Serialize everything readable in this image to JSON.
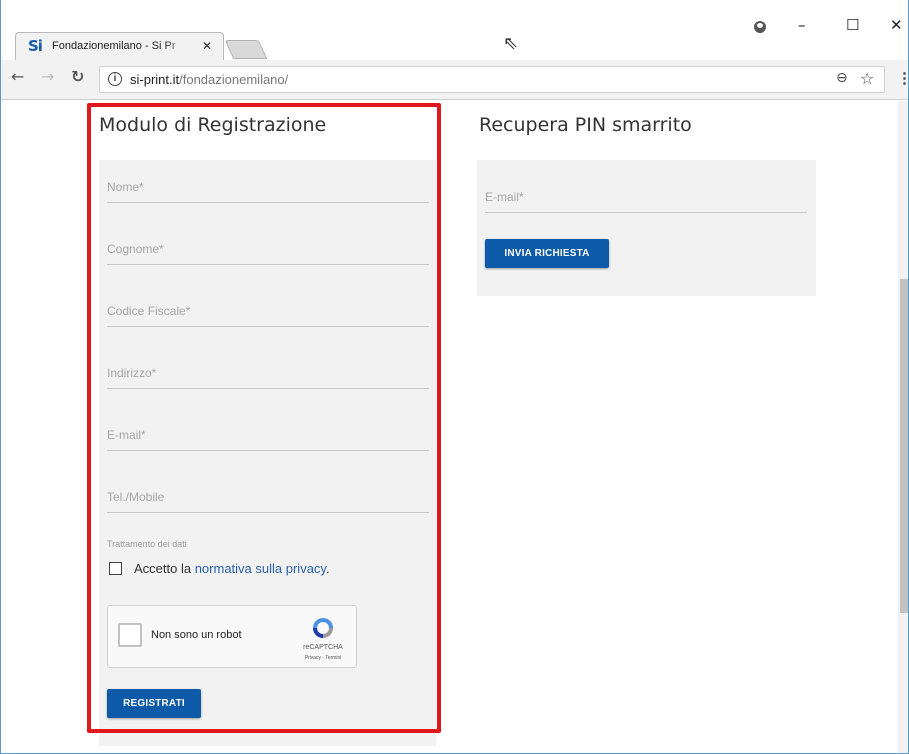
{
  "browser": {
    "tab_title": "Fondazionemilano - Si Pr",
    "favicon_text": "Si",
    "url_host": "si-print.it",
    "url_path": "/fondazionemilano/",
    "win_minimize": "–",
    "win_maximize": "☐",
    "win_close": "✕"
  },
  "registration": {
    "title": "Modulo di Registrazione",
    "fields": {
      "nome": "Nome*",
      "cognome": "Cognome*",
      "codice_fiscale": "Codice Fiscale*",
      "indirizzo": "Indirizzo*",
      "email": "E-mail*",
      "telefono": "Tel./Mobile"
    },
    "privacy_caption": "Trattamento dei dati",
    "privacy_prefix": "Accetto la ",
    "privacy_link": "normativa sulla privacy",
    "privacy_suffix": ".",
    "recaptcha": {
      "label": "Non sono un robot",
      "brand": "reCAPTCHA",
      "terms": "Privacy - Termini"
    },
    "submit_label": "REGISTRATI"
  },
  "recover_pin": {
    "title": "Recupera PIN smarrito",
    "email_placeholder": "E-mail*",
    "submit_label": "INVIA RICHIESTA"
  },
  "icons": {
    "back": "back-arrow-icon",
    "forward": "forward-arrow-icon",
    "reload": "reload-icon",
    "info": "info-icon",
    "zoom": "zoom-icon",
    "bookmark": "star-icon",
    "menu": "kebab-menu-icon",
    "profile": "profile-icon"
  },
  "colors": {
    "accent": "#0d5ba8",
    "link": "#2a62a8",
    "highlight_outline": "#e0181e",
    "panel": "#f2f2f2"
  }
}
